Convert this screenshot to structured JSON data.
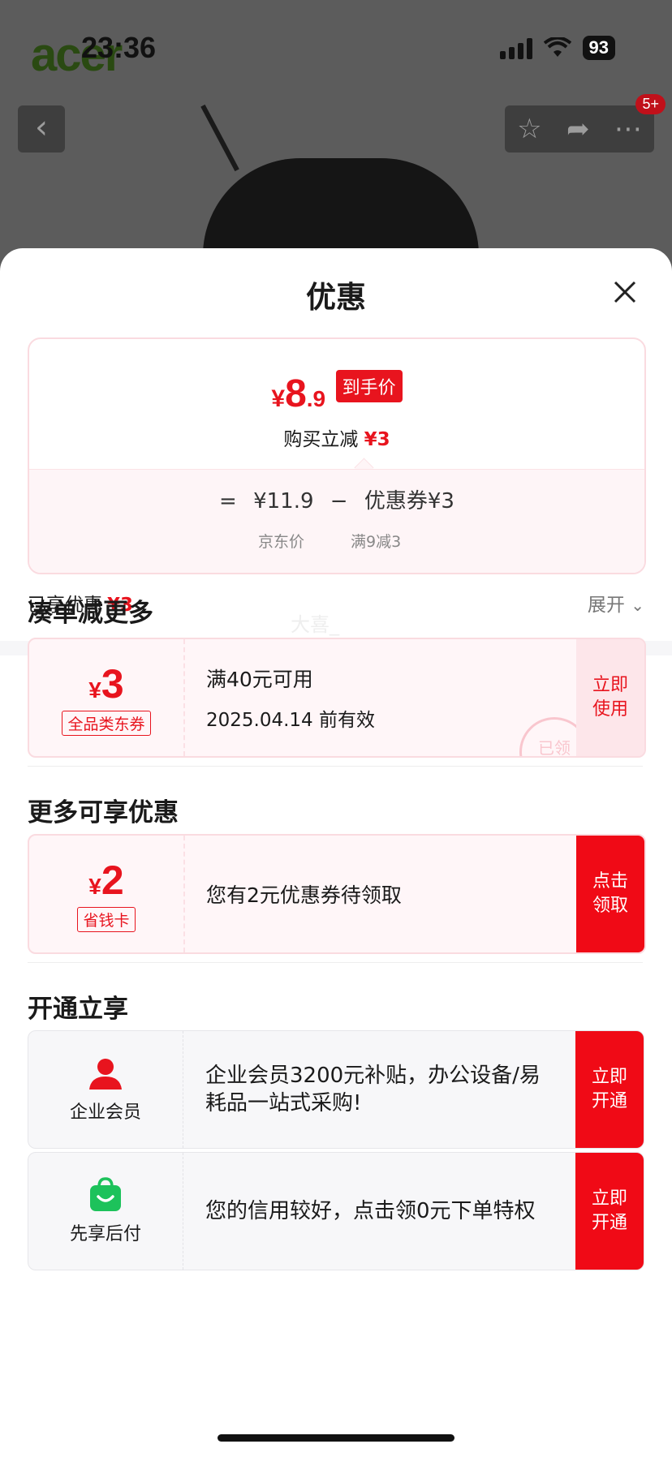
{
  "status_bar": {
    "time": "23:36",
    "battery": "93"
  },
  "background": {
    "logo_text": "acer",
    "more_badge": "5+"
  },
  "sheet": {
    "title": "优惠",
    "price_card": {
      "currency": "¥",
      "price_int": "8",
      "price_dec": ".9",
      "price_tag": "到手价",
      "reduce_text": "购买立减",
      "reduce_amount": "¥3",
      "formula": [
        "=",
        "¥11.9",
        "−",
        "优惠券¥3"
      ],
      "jd_price_label": "京东价",
      "coupon_rule_label": "满9减3"
    },
    "enjoyed_label": "已享优惠",
    "enjoyed_amount": "¥3",
    "expand_label": "展开",
    "watermark": "大喜_",
    "section1": {
      "title": "凑单减更多",
      "coupon": {
        "currency": "¥",
        "amount": "3",
        "type": "全品类东券",
        "condition": "满40元可用",
        "expiry": "2025.04.14 前有效",
        "action": [
          "立即",
          "使用"
        ],
        "stamp": "已领"
      }
    },
    "section2": {
      "title": "更多可享优惠",
      "coupon": {
        "currency": "¥",
        "amount": "2",
        "type": "省钱卡",
        "desc": "您有2元优惠券待领取",
        "action": [
          "点击",
          "领取"
        ]
      }
    },
    "section3": {
      "title": "开通立享",
      "items": [
        {
          "name": "企业会员",
          "icon": "user-icon",
          "desc": "企业会员3200元补贴，办公设备/易耗品一站式采购!",
          "action": [
            "立即",
            "开通"
          ]
        },
        {
          "name": "先享后付",
          "icon": "shopping-bag-icon",
          "desc": "您的信用较好，点击领0元下单特权",
          "action": [
            "立即",
            "开通"
          ]
        }
      ]
    }
  },
  "colors": {
    "accent": "#e8141e",
    "pink_bg": "#fff6f8",
    "green_icon": "#1dc25b"
  }
}
